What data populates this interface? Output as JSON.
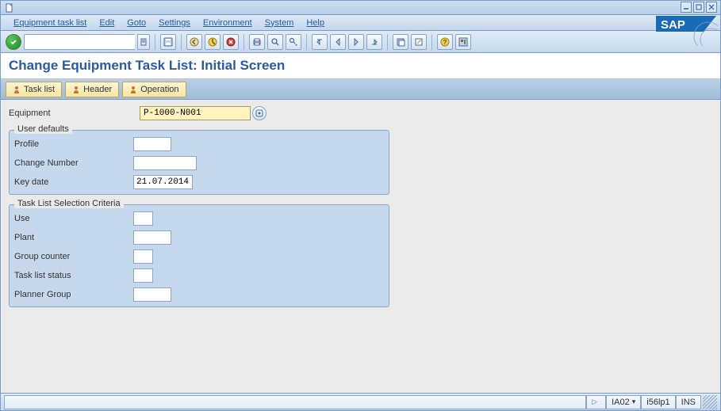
{
  "menu": {
    "items": [
      "Equipment task list",
      "Edit",
      "Goto",
      "Settings",
      "Environment",
      "System",
      "Help"
    ]
  },
  "screen_title": "Change Equipment Task List: Initial Screen",
  "app_toolbar": {
    "tasklist_label": "Task list",
    "header_label": "Header",
    "operation_label": "Operation"
  },
  "fields": {
    "equipment_label": "Equipment",
    "equipment_value": "P-1000-N001"
  },
  "user_defaults": {
    "title": "User defaults",
    "profile_label": "Profile",
    "profile_value": "",
    "change_number_label": "Change Number",
    "change_number_value": "",
    "key_date_label": "Key date",
    "key_date_value": "21.07.2014"
  },
  "selection": {
    "title": "Task List Selection Criteria",
    "use_label": "Use",
    "use_value": "",
    "plant_label": "Plant",
    "plant_value": "",
    "group_counter_label": "Group counter",
    "group_counter_value": "",
    "tasklist_status_label": "Task list status",
    "tasklist_status_value": "",
    "planner_group_label": "Planner Group",
    "planner_group_value": ""
  },
  "statusbar": {
    "tcode": "IA02",
    "system": "i56lp1",
    "mode": "INS"
  }
}
